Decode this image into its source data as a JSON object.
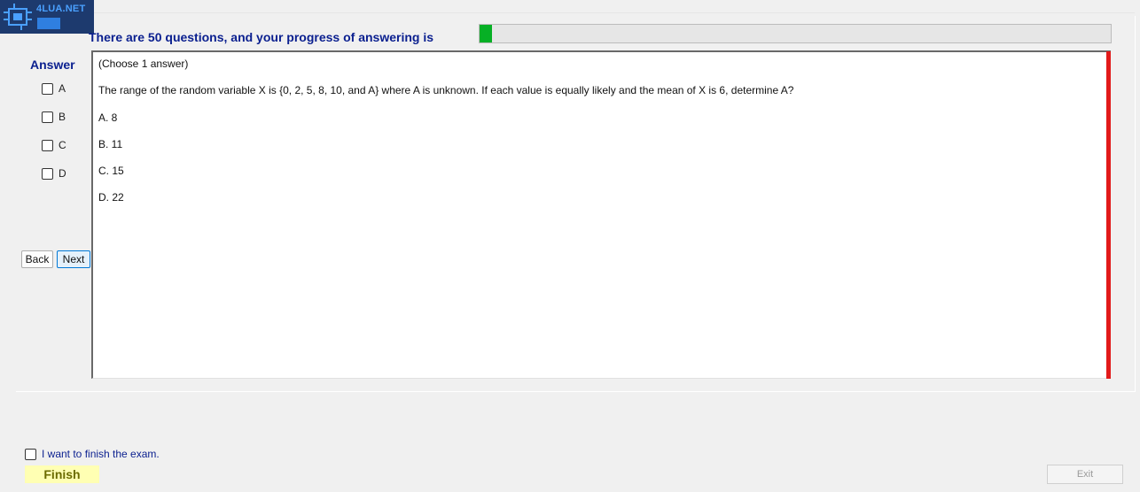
{
  "logo": {
    "text": "4LUA.NET",
    "badge": ""
  },
  "progress": {
    "label": "There are 50 questions, and your progress of answering is",
    "value_fraction": 0.02,
    "fill_color": "#06b025"
  },
  "answer": {
    "title": "Answer",
    "options": [
      "A",
      "B",
      "C",
      "D"
    ]
  },
  "nav": {
    "back_label": "Back",
    "next_label": "Next"
  },
  "question": {
    "instruction": "(Choose 1 answer)",
    "text": "The range of the random variable X is {0, 2, 5, 8, 10, and A} where A is unknown. If each value is equally likely and the mean of X is 6, determine A?",
    "choices": [
      "A.  8",
      "B.  11",
      "C.  15",
      "D.  22"
    ]
  },
  "finish": {
    "checkbox_label": "I want to finish the exam.",
    "finish_label": "Finish",
    "exit_label": "Exit"
  },
  "colors": {
    "accent_text": "#0a1f8f",
    "scroll_indicator": "#e21a1a",
    "finish_bg": "#ffffb3"
  }
}
